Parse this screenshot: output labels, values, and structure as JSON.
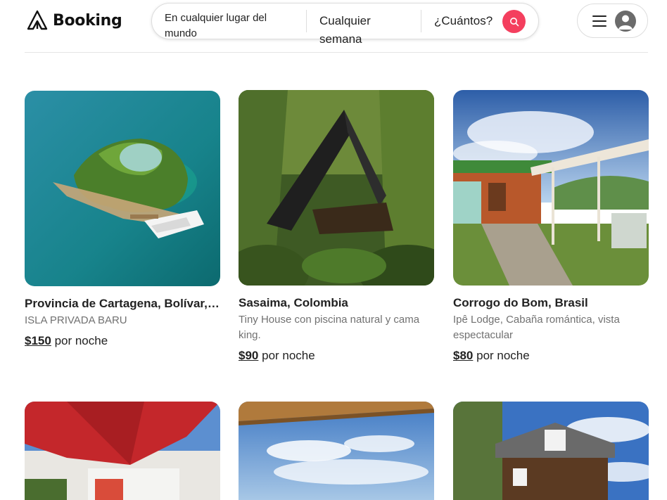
{
  "brand": {
    "name": "Booking",
    "accent": "#f43f5e"
  },
  "search": {
    "where": "En cualquier lugar del mundo",
    "when": "Cualquier semana",
    "who": "¿Cuántos?",
    "button_icon": "search-icon"
  },
  "user_menu": {
    "menu_icon": "hamburger-icon",
    "avatar_icon": "user-avatar-icon"
  },
  "listings": [
    {
      "title": "Provincia de Cartagena, Bolívar, Colombia",
      "subtitle": "ISLA PRIVADA BARU",
      "price": "$150",
      "price_suffix": "por noche",
      "image": "island-with-yacht"
    },
    {
      "title": "Sasaima, Colombia",
      "subtitle": "Tiny House con piscina natural y cama king.",
      "price": "$90",
      "price_suffix": "por noche",
      "image": "a-frame-cabin-in-forest"
    },
    {
      "title": "Corrogo do Bom, Brasil",
      "subtitle": "Ipê Lodge, Cabaña romántica, vista espectacular",
      "price": "$80",
      "price_suffix": "por noche",
      "image": "wooden-cabin-with-pergola"
    },
    {
      "image": "red-umbrella-terrace"
    },
    {
      "image": "sky-with-clouds-roof"
    },
    {
      "image": "cottage-with-trees"
    }
  ]
}
